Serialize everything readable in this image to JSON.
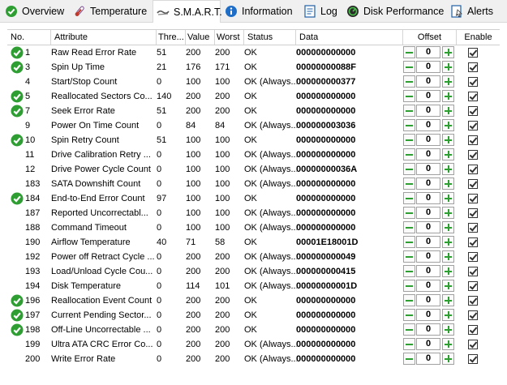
{
  "tabs": [
    {
      "label": "Overview",
      "icon": "overview-icon"
    },
    {
      "label": "Temperature",
      "icon": "thermometer-icon"
    },
    {
      "label": "S.M.A.R.T.",
      "icon": "smart-icon",
      "active": true
    },
    {
      "label": "Information",
      "icon": "information-icon"
    },
    {
      "label": "Log",
      "icon": "log-icon"
    },
    {
      "label": "Disk Performance",
      "icon": "disk-performance-icon"
    },
    {
      "label": "Alerts",
      "icon": "alerts-icon"
    }
  ],
  "columns": {
    "no": "No.",
    "attribute": "Attribute",
    "threshold": "Thre...",
    "value": "Value",
    "worst": "Worst",
    "status": "Status",
    "data": "Data",
    "offset": "Offset",
    "enable": "Enable"
  },
  "rows": [
    {
      "no": "1",
      "attribute": "Raw Read Error Rate",
      "threshold": "51",
      "value": "200",
      "worst": "200",
      "status": "OK",
      "data": "000000000000",
      "offset": "0",
      "ok_icon": true
    },
    {
      "no": "3",
      "attribute": "Spin Up Time",
      "threshold": "21",
      "value": "176",
      "worst": "171",
      "status": "OK",
      "data": "00000000088F",
      "offset": "0",
      "ok_icon": true
    },
    {
      "no": "4",
      "attribute": "Start/Stop Count",
      "threshold": "0",
      "value": "100",
      "worst": "100",
      "status": "OK (Always...",
      "data": "000000000377",
      "offset": "0",
      "ok_icon": false
    },
    {
      "no": "5",
      "attribute": "Reallocated Sectors Co...",
      "threshold": "140",
      "value": "200",
      "worst": "200",
      "status": "OK",
      "data": "000000000000",
      "offset": "0",
      "ok_icon": true
    },
    {
      "no": "7",
      "attribute": "Seek Error Rate",
      "threshold": "51",
      "value": "200",
      "worst": "200",
      "status": "OK",
      "data": "000000000000",
      "offset": "0",
      "ok_icon": true
    },
    {
      "no": "9",
      "attribute": "Power On Time Count",
      "threshold": "0",
      "value": "84",
      "worst": "84",
      "status": "OK (Always...",
      "data": "000000003036",
      "offset": "0",
      "ok_icon": false
    },
    {
      "no": "10",
      "attribute": "Spin Retry Count",
      "threshold": "51",
      "value": "100",
      "worst": "100",
      "status": "OK",
      "data": "000000000000",
      "offset": "0",
      "ok_icon": true
    },
    {
      "no": "11",
      "attribute": "Drive Calibration Retry ...",
      "threshold": "0",
      "value": "100",
      "worst": "100",
      "status": "OK (Always...",
      "data": "000000000000",
      "offset": "0",
      "ok_icon": false
    },
    {
      "no": "12",
      "attribute": "Drive Power Cycle Count",
      "threshold": "0",
      "value": "100",
      "worst": "100",
      "status": "OK (Always...",
      "data": "00000000036A",
      "offset": "0",
      "ok_icon": false
    },
    {
      "no": "183",
      "attribute": "SATA Downshift Count",
      "threshold": "0",
      "value": "100",
      "worst": "100",
      "status": "OK (Always...",
      "data": "000000000000",
      "offset": "0",
      "ok_icon": false
    },
    {
      "no": "184",
      "attribute": "End-to-End Error Count",
      "threshold": "97",
      "value": "100",
      "worst": "100",
      "status": "OK",
      "data": "000000000000",
      "offset": "0",
      "ok_icon": true
    },
    {
      "no": "187",
      "attribute": "Reported Uncorrectabl...",
      "threshold": "0",
      "value": "100",
      "worst": "100",
      "status": "OK (Always...",
      "data": "000000000000",
      "offset": "0",
      "ok_icon": false
    },
    {
      "no": "188",
      "attribute": "Command Timeout",
      "threshold": "0",
      "value": "100",
      "worst": "100",
      "status": "OK (Always...",
      "data": "000000000000",
      "offset": "0",
      "ok_icon": false
    },
    {
      "no": "190",
      "attribute": "Airflow Temperature",
      "threshold": "40",
      "value": "71",
      "worst": "58",
      "status": "OK",
      "data": "00001E18001D",
      "offset": "0",
      "ok_icon": false
    },
    {
      "no": "192",
      "attribute": "Power off Retract Cycle ...",
      "threshold": "0",
      "value": "200",
      "worst": "200",
      "status": "OK (Always...",
      "data": "000000000049",
      "offset": "0",
      "ok_icon": false
    },
    {
      "no": "193",
      "attribute": "Load/Unload Cycle Cou...",
      "threshold": "0",
      "value": "200",
      "worst": "200",
      "status": "OK (Always...",
      "data": "000000000415",
      "offset": "0",
      "ok_icon": false
    },
    {
      "no": "194",
      "attribute": "Disk Temperature",
      "threshold": "0",
      "value": "114",
      "worst": "101",
      "status": "OK (Always...",
      "data": "00000000001D",
      "offset": "0",
      "ok_icon": false
    },
    {
      "no": "196",
      "attribute": "Reallocation Event Count",
      "threshold": "0",
      "value": "200",
      "worst": "200",
      "status": "OK",
      "data": "000000000000",
      "offset": "0",
      "ok_icon": true
    },
    {
      "no": "197",
      "attribute": "Current Pending Sector...",
      "threshold": "0",
      "value": "200",
      "worst": "200",
      "status": "OK",
      "data": "000000000000",
      "offset": "0",
      "ok_icon": true
    },
    {
      "no": "198",
      "attribute": "Off-Line Uncorrectable ...",
      "threshold": "0",
      "value": "200",
      "worst": "200",
      "status": "OK",
      "data": "000000000000",
      "offset": "0",
      "ok_icon": true
    },
    {
      "no": "199",
      "attribute": "Ultra ATA CRC Error Co...",
      "threshold": "0",
      "value": "200",
      "worst": "200",
      "status": "OK (Always...",
      "data": "000000000000",
      "offset": "0",
      "ok_icon": false
    },
    {
      "no": "200",
      "attribute": "Write Error Rate",
      "threshold": "0",
      "value": "200",
      "worst": "200",
      "status": "OK (Always...",
      "data": "000000000000",
      "offset": "0",
      "ok_icon": false
    }
  ],
  "colors": {
    "ok_green": "#2e9e33",
    "grid_line": "#cfcfcf",
    "tab_bg": "#f0f0f0"
  }
}
